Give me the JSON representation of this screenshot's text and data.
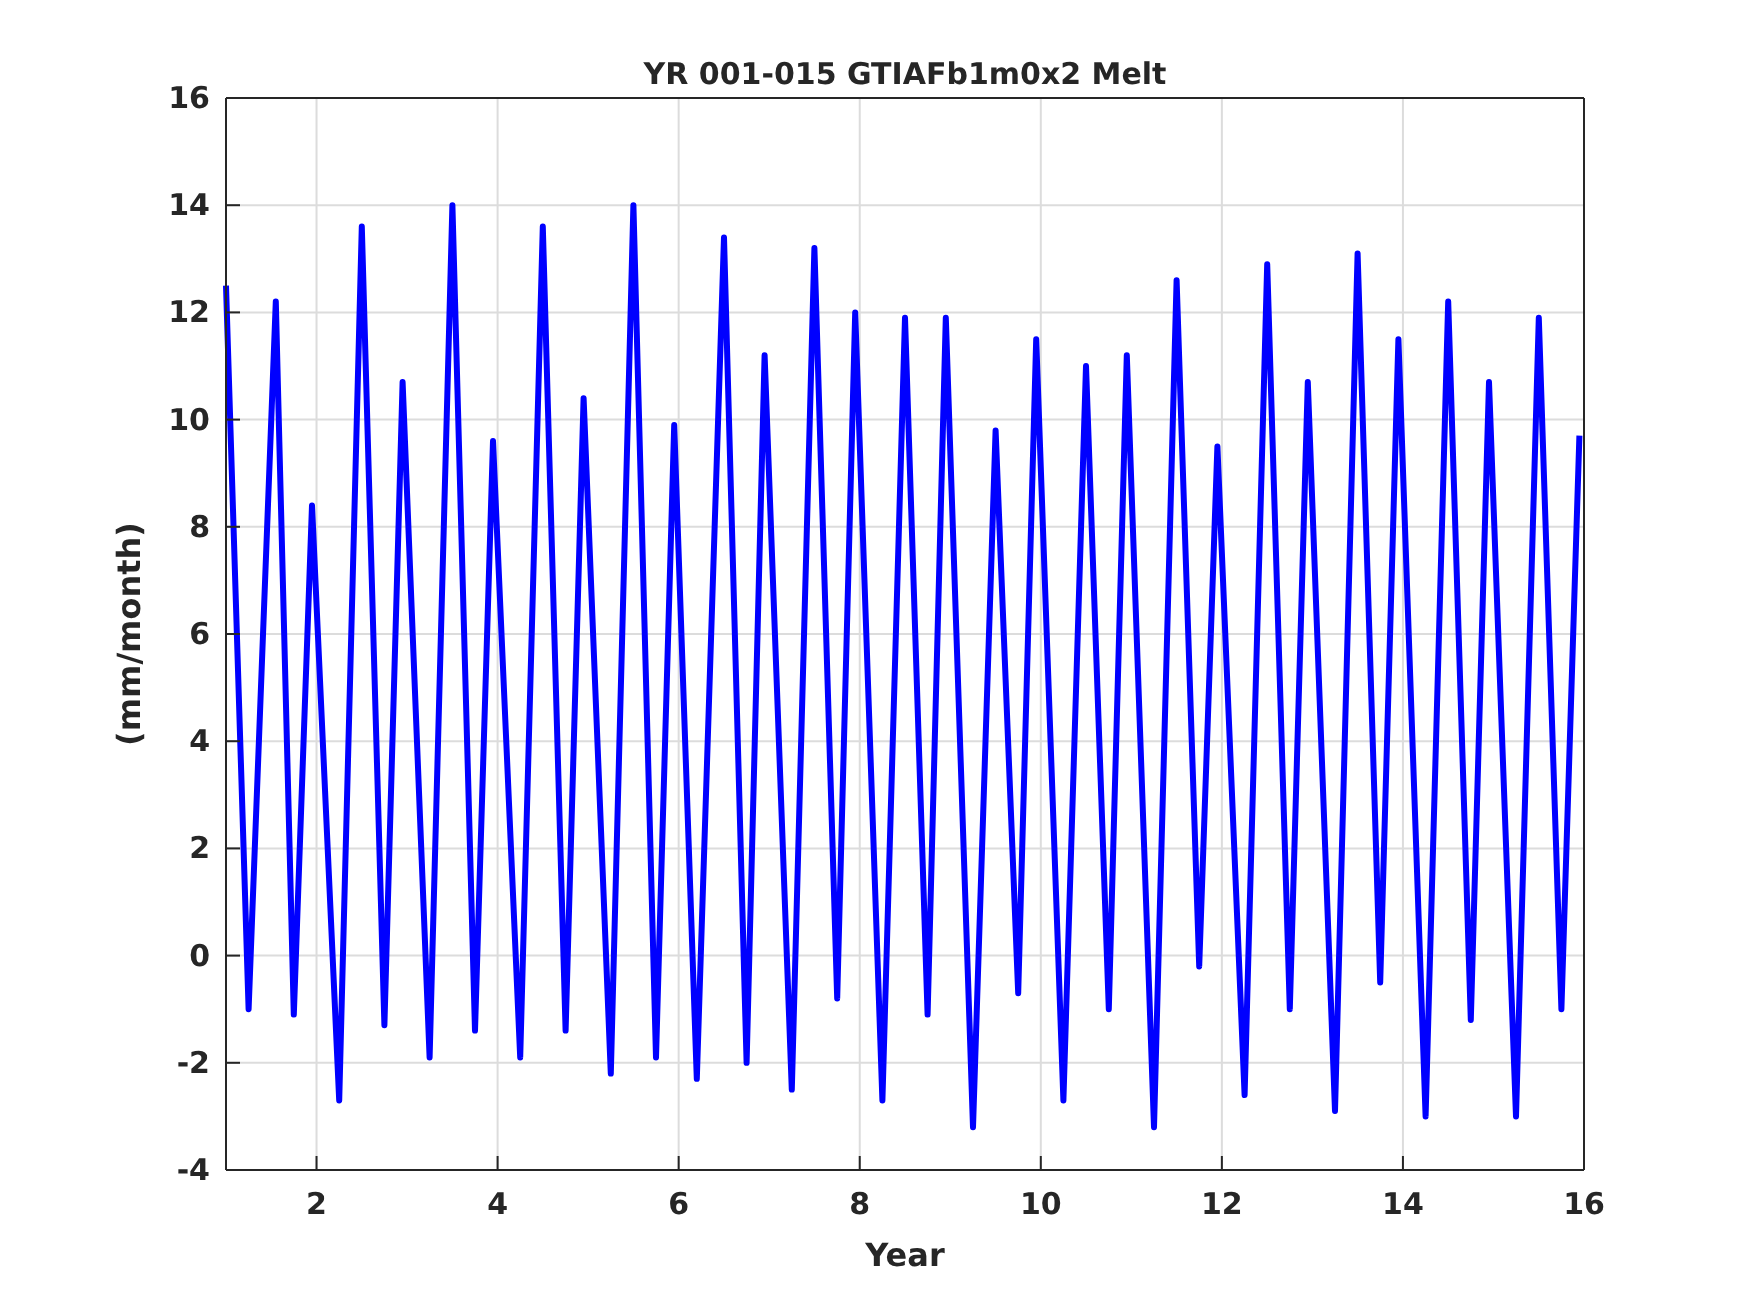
{
  "figure": {
    "chart_data": {
      "type": "line",
      "title": "YR 001-015 GTIAFb1m0x2 Melt",
      "xlabel": "Year",
      "ylabel": "(mm/month)",
      "x": [
        1.0,
        1.25,
        1.55,
        1.75,
        1.95,
        2.25,
        2.5,
        2.75,
        2.95,
        3.25,
        3.5,
        3.75,
        3.95,
        4.25,
        4.5,
        4.75,
        4.95,
        5.25,
        5.5,
        5.75,
        5.95,
        6.2,
        6.5,
        6.75,
        6.95,
        7.25,
        7.5,
        7.75,
        7.95,
        8.25,
        8.5,
        8.75,
        8.95,
        9.25,
        9.5,
        9.75,
        9.95,
        10.25,
        10.5,
        10.75,
        10.95,
        11.25,
        11.5,
        11.75,
        11.95,
        12.25,
        12.5,
        12.75,
        12.95,
        13.25,
        13.5,
        13.75,
        13.95,
        14.25,
        14.5,
        14.75,
        14.95,
        15.25,
        15.5,
        15.75,
        15.95
      ],
      "grid": true,
      "series": [
        {
          "color": "#0000ff",
          "values": [
            12.5,
            -1.0,
            12.2,
            -1.1,
            8.4,
            -2.7,
            13.6,
            -1.3,
            10.7,
            -1.9,
            14.0,
            -1.4,
            9.6,
            -1.9,
            13.6,
            -1.4,
            10.4,
            -2.2,
            14.0,
            -1.9,
            9.9,
            -2.3,
            13.4,
            -2.0,
            11.2,
            -2.5,
            13.2,
            -0.8,
            12.0,
            -2.7,
            11.9,
            -1.1,
            11.9,
            -3.2,
            9.8,
            -0.7,
            11.5,
            -2.7,
            11.0,
            -1.0,
            11.2,
            -3.2,
            12.6,
            -0.2,
            9.5,
            -2.6,
            12.9,
            -1.0,
            10.7,
            -2.9,
            13.1,
            -0.5,
            11.5,
            -3.0,
            12.2,
            -1.2,
            10.7,
            -3.0,
            11.9,
            -1.0,
            9.7
          ]
        }
      ],
      "xlim": [
        1,
        16
      ],
      "ylim": [
        -4,
        16
      ],
      "xticks": [
        2,
        4,
        6,
        8,
        10,
        12,
        14,
        16
      ],
      "yticks": [
        -4,
        -2,
        0,
        2,
        4,
        6,
        8,
        10,
        12,
        14,
        16
      ]
    }
  }
}
